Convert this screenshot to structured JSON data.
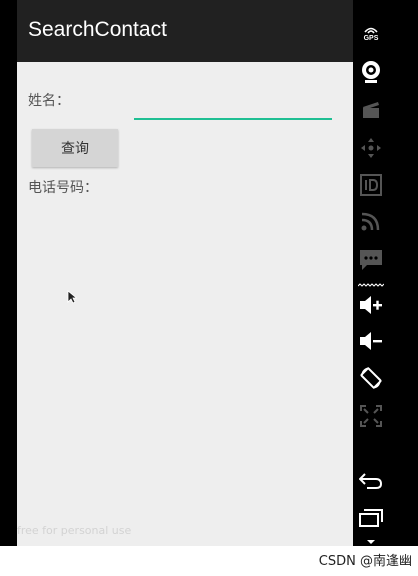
{
  "app_bar": {
    "title": "SearchContact"
  },
  "form": {
    "name_label": "姓名：",
    "name_value": "",
    "query_button_label": "查询",
    "phone_label": "电话号码："
  },
  "emulator_panel": {
    "gps_label": "GPS",
    "icons": [
      "gps-icon",
      "camera-icon",
      "clapper-icon",
      "dpad-icon",
      "id-icon",
      "rss-icon",
      "message-icon",
      "volume-up-icon",
      "volume-down-icon",
      "rotate-icon",
      "fullscreen-icon",
      "back-icon",
      "recent-apps-icon"
    ]
  },
  "overlay": {
    "faint_text": "free for personal use",
    "watermark": "CSDN @南逢幽"
  },
  "colors": {
    "app_bar": "#212121",
    "accent_underline": "#1fbf93",
    "content_bg": "#eeeeee",
    "button_bg": "#d5d5d5"
  }
}
